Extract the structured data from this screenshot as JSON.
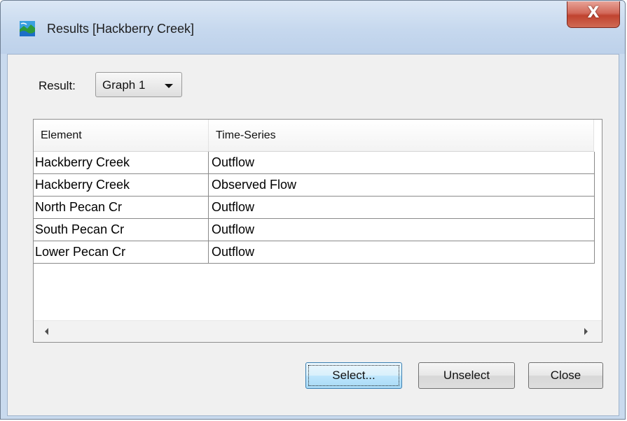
{
  "window": {
    "title": "Results [Hackberry Creek]",
    "app_icon": "hms-landscape-icon",
    "close_glyph": "X"
  },
  "result": {
    "label": "Result:",
    "selected": "Graph 1"
  },
  "table": {
    "columns": [
      "Element",
      "Time-Series"
    ],
    "rows": [
      {
        "element": "Hackberry Creek",
        "time_series": "Outflow"
      },
      {
        "element": "Hackberry Creek",
        "time_series": "Observed Flow"
      },
      {
        "element": "North Pecan Cr",
        "time_series": "Outflow"
      },
      {
        "element": "South Pecan Cr",
        "time_series": "Outflow"
      },
      {
        "element": "Lower Pecan Cr",
        "time_series": "Outflow"
      }
    ]
  },
  "buttons": {
    "select": "Select...",
    "unselect": "Unselect",
    "close": "Close"
  },
  "colors": {
    "frame": "#c9daee",
    "client": "#f0f0f0",
    "close_red": "#c0432f",
    "focus_blue": "#3c7fb1"
  }
}
